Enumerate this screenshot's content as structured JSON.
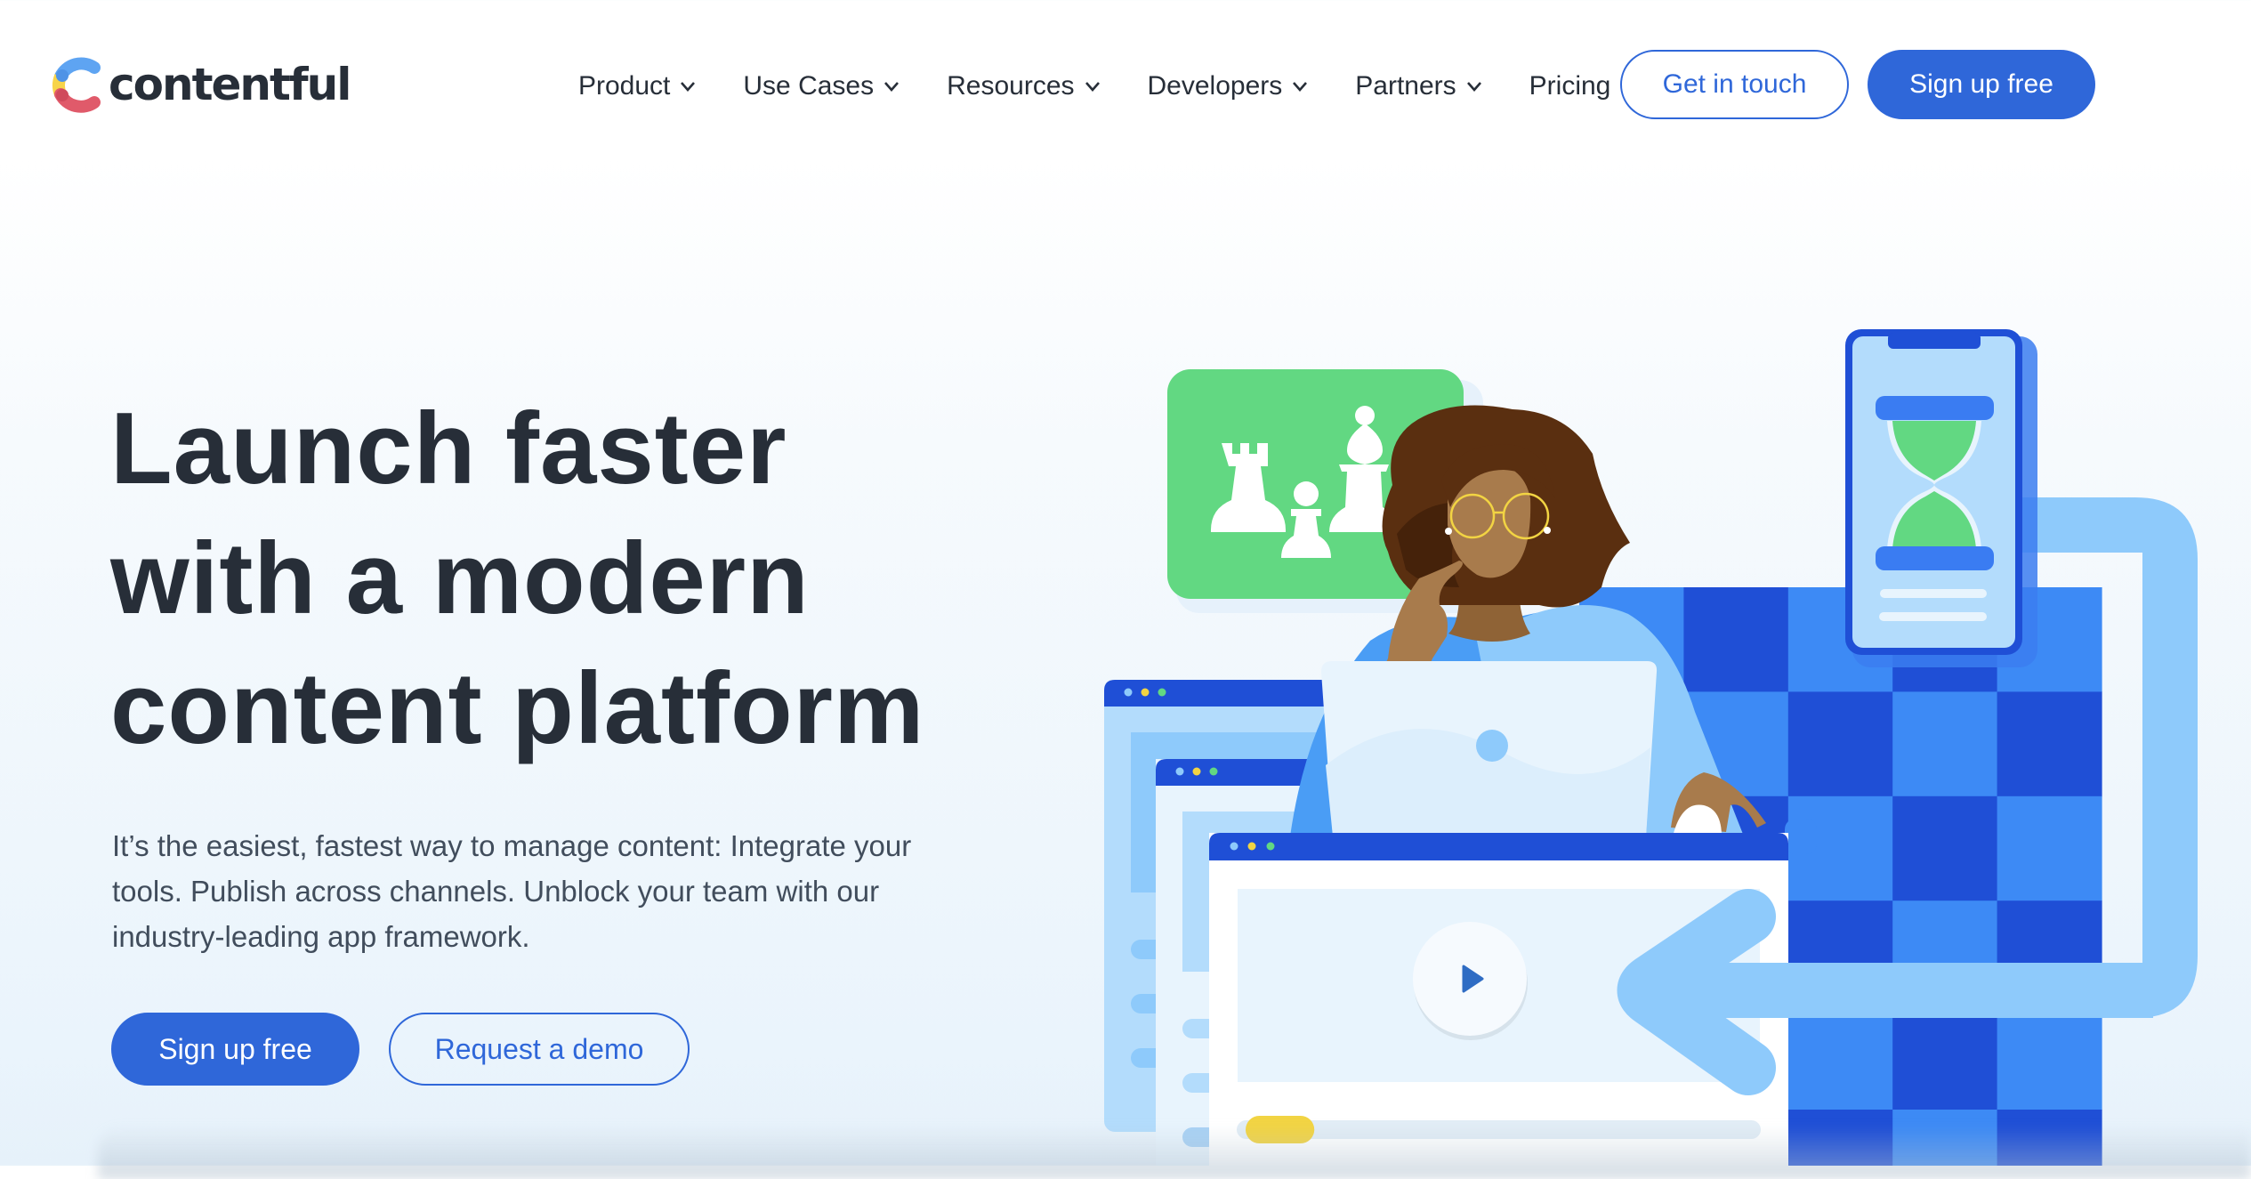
{
  "brand": {
    "name": "contentful",
    "logo_icon": "contentful-c-logo-icon",
    "colors": {
      "primary": "#2f67d9",
      "text_dark": "#272e38",
      "text_body": "#414d5c",
      "logo_blue": "#5ea4f2",
      "logo_yellow": "#f7d449",
      "logo_red": "#e05a6a"
    }
  },
  "nav": {
    "items": [
      {
        "label": "Product",
        "has_dropdown": true,
        "icon": "chevron-down-icon"
      },
      {
        "label": "Use Cases",
        "has_dropdown": true,
        "icon": "chevron-down-icon"
      },
      {
        "label": "Resources",
        "has_dropdown": true,
        "icon": "chevron-down-icon"
      },
      {
        "label": "Developers",
        "has_dropdown": true,
        "icon": "chevron-down-icon"
      },
      {
        "label": "Partners",
        "has_dropdown": true,
        "icon": "chevron-down-icon"
      },
      {
        "label": "Pricing",
        "has_dropdown": false
      }
    ],
    "get_in_touch_label": "Get in touch",
    "sign_up_label": "Sign up free"
  },
  "hero": {
    "title_lines": [
      "Launch faster",
      "with a modern",
      "content platform"
    ],
    "body": "It’s the easiest, fastest way to manage content: Integrate your tools. Publish across channels. Unblock your team with our industry-leading app framework.",
    "primary_cta": "Sign up free",
    "secondary_cta": "Request a demo"
  },
  "illustration": {
    "description": "Woman with glasses at laptop, chess pieces card, phone with hourglass, browser windows with video player, checkerboard and looping arrow",
    "elements": [
      "chess-card",
      "chess-rook-icon",
      "chess-pawn-icon",
      "chess-bishop-icon",
      "woman-figure",
      "laptop",
      "phone",
      "hourglass-icon",
      "checkerboard",
      "loop-arrow",
      "browser-window-back",
      "browser-window-middle",
      "browser-window-front",
      "play-icon",
      "video-progress-bar"
    ],
    "video_progress": 0.07,
    "colors": {
      "green": "#62d882",
      "blue_dark": "#1f4fd6",
      "blue_mid": "#3d8af5",
      "blue_light": "#8ecafb",
      "blue_pale": "#b3dcfc",
      "yellow": "#f2d443",
      "hair": "#5a2f10",
      "skin": "#a87b4c"
    }
  }
}
